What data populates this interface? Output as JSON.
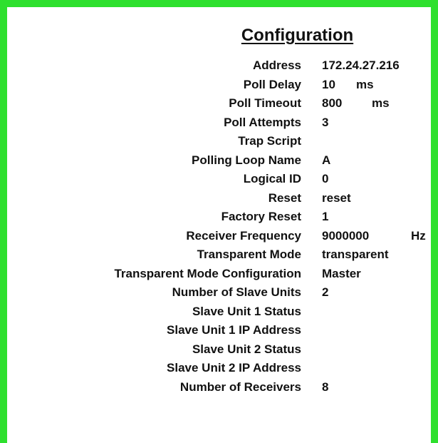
{
  "title": "Configuration",
  "rows": [
    {
      "label": "Address",
      "value": "172.24.27.216",
      "unit": ""
    },
    {
      "label": "Poll Delay",
      "value": "10",
      "unit": "ms"
    },
    {
      "label": "Poll Timeout",
      "value": "800",
      "unit": "ms"
    },
    {
      "label": "Poll Attempts",
      "value": "3",
      "unit": ""
    },
    {
      "label": "Trap Script",
      "value": "",
      "unit": ""
    },
    {
      "label": "Polling Loop Name",
      "value": "A",
      "unit": ""
    },
    {
      "label": "Logical ID",
      "value": "0",
      "unit": ""
    },
    {
      "label": "Reset",
      "value": "reset",
      "unit": ""
    },
    {
      "label": "Factory Reset",
      "value": "1",
      "unit": ""
    },
    {
      "label": "Receiver Frequency",
      "value": "9000000",
      "unit": "Hz"
    },
    {
      "label": "Transparent Mode",
      "value": "transparent",
      "unit": ""
    },
    {
      "label": "Transparent Mode Configuration",
      "value": "Master",
      "unit": ""
    },
    {
      "label": "Number of Slave Units",
      "value": "2",
      "unit": ""
    },
    {
      "label": "Slave Unit 1 Status",
      "value": "",
      "unit": ""
    },
    {
      "label": "Slave Unit 1 IP Address",
      "value": "",
      "unit": ""
    },
    {
      "label": "Slave Unit 2 Status",
      "value": "",
      "unit": ""
    },
    {
      "label": "Slave Unit 2 IP Address",
      "value": "",
      "unit": ""
    },
    {
      "label": "Number of Receivers",
      "value": "8",
      "unit": ""
    }
  ],
  "colors": {
    "frame_border": "#2ee02e",
    "background": "#ffffff",
    "text": "#111111"
  }
}
